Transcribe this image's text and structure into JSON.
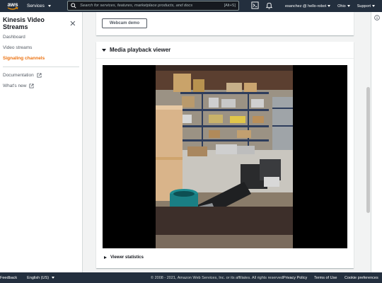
{
  "header": {
    "logo": "aws",
    "services_label": "Services",
    "search_placeholder": "Search for services, features, marketplace products, and docs",
    "search_shortcut": "[Alt+S]",
    "user_label": "esanchez @ hello-robot",
    "region_label": "Ohio",
    "support_label": "Support",
    "icons": [
      "terminal-icon",
      "bell-icon"
    ]
  },
  "sidebar": {
    "title": "Kinesis Video Streams",
    "items": [
      {
        "label": "Dashboard"
      },
      {
        "label": "Video streams"
      },
      {
        "label": "Signaling channels",
        "active": true
      }
    ],
    "links": [
      {
        "label": "Documentation"
      },
      {
        "label": "What's new"
      }
    ]
  },
  "main": {
    "webcam_button": "Webcam demo",
    "viewer_title": "Media playback viewer",
    "viewer_statistics": "Viewer statistics"
  },
  "footer": {
    "feedback": "Feedback",
    "language": "English (US)",
    "copyright": "© 2008 - 2021, Amazon Web Services, Inc. or its affiliates. All rights reserved.",
    "privacy": "Privacy Policy",
    "terms": "Terms of Use",
    "cookies": "Cookie preferences"
  },
  "colors": {
    "nav_bg": "#232f3e",
    "accent": "#ec7211",
    "page_bg": "#f2f3f3"
  }
}
